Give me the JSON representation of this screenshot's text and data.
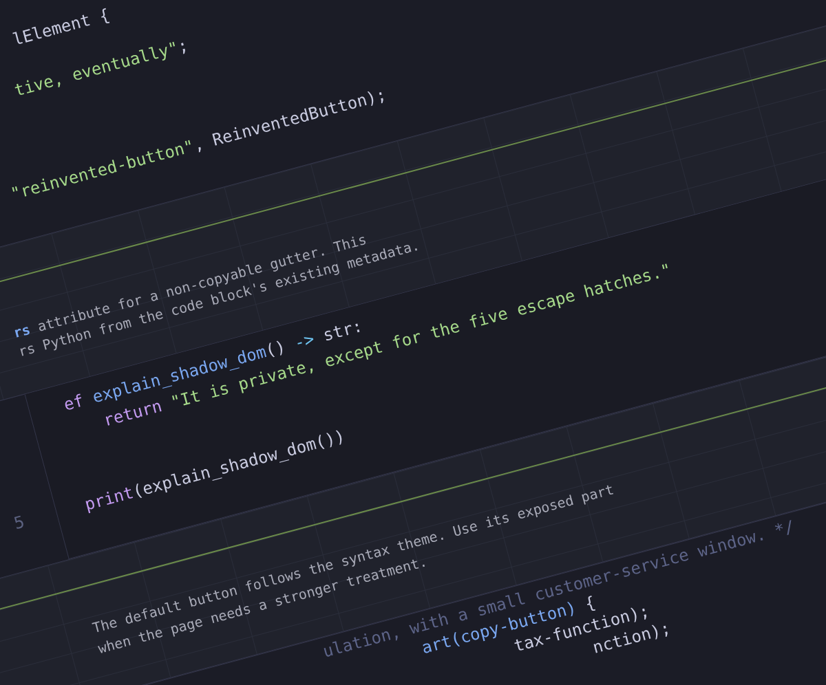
{
  "blocks": [
    {
      "kind": "code",
      "lines": [
        {
          "segments": [
            {
              "text": "lElement {",
              "kind": "plain"
            }
          ]
        },
        {
          "segments": [
            {
              "text": "tive, eventually\"",
              "kind": "string"
            },
            {
              "text": ";",
              "kind": "plain"
            }
          ]
        },
        {
          "segments": [
            {
              "text": "\"reinvented-button\"",
              "kind": "string"
            },
            {
              "text": ", ReinventedButton);",
              "kind": "plain"
            }
          ]
        }
      ]
    },
    {
      "kind": "prose",
      "lines": [
        [
          {
            "text": "rs",
            "kind": "inline_code"
          },
          {
            "text": " attribute for a non-copyable gutter. This",
            "kind": "text"
          }
        ],
        [
          {
            "text": "rs Python from the code block's existing metadata.",
            "kind": "text"
          }
        ]
      ]
    },
    {
      "kind": "code",
      "lines": [
        {
          "segments": [
            {
              "text": "ef",
              "kind": "keyword"
            },
            {
              "text": " explain_shadow_dom",
              "kind": "function"
            },
            {
              "text": "() ",
              "kind": "plain"
            },
            {
              "text": "->",
              "kind": "operator"
            },
            {
              "text": " str:",
              "kind": "plain"
            }
          ]
        },
        {
          "segments": [
            {
              "text": "return",
              "kind": "keyword"
            },
            {
              "text": " \"It is private, except for the five escape hatches.\"",
              "kind": "string"
            }
          ]
        },
        {
          "number": "5",
          "segments": [
            {
              "text": "print",
              "kind": "keyword"
            },
            {
              "text": "(explain_shadow_dom())",
              "kind": "plain"
            }
          ]
        }
      ]
    },
    {
      "kind": "prose",
      "lines": [
        [
          {
            "text": "The default button follows the syntax theme. Use its exposed part",
            "kind": "text"
          }
        ],
        [
          {
            "text": "when the page needs a stronger treatment.",
            "kind": "text"
          }
        ]
      ]
    },
    {
      "kind": "code",
      "lines": [
        {
          "segments": [
            {
              "text": "ulation, with a small customer-service window. */",
              "kind": "comment"
            }
          ]
        },
        {
          "segments": [
            {
              "text": "art(copy-button)",
              "kind": "function"
            },
            {
              "text": " {",
              "kind": "plain"
            }
          ]
        },
        {
          "segments": [
            {
              "text": "tax-function);",
              "kind": "plain"
            }
          ]
        },
        {
          "segments": [
            {
              "text": "nction);",
              "kind": "plain"
            }
          ]
        }
      ]
    }
  ]
}
